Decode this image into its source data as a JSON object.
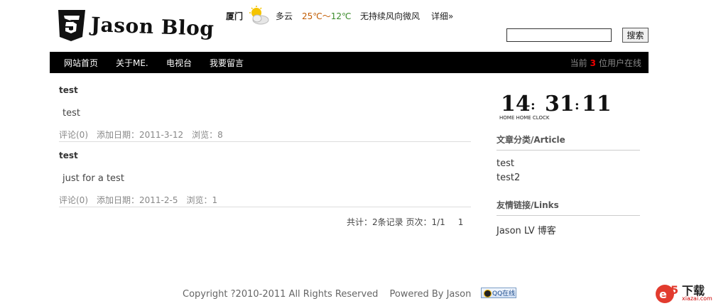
{
  "header": {
    "logo_text": "Jason Blog",
    "weather": {
      "city": "厦门",
      "icon": "partly-cloudy-icon",
      "condition": "多云",
      "temp_high": "25℃",
      "temp_sep": "～",
      "temp_low": "12℃",
      "wind": "无持续风向微风",
      "detail_label": "详细»"
    },
    "search": {
      "value": "",
      "button_label": "搜索"
    }
  },
  "nav": {
    "items": [
      {
        "label": "网站首页"
      },
      {
        "label": "关于ME."
      },
      {
        "label": "电视台"
      },
      {
        "label": "我要留言"
      }
    ],
    "online_prefix": "当前",
    "online_count": "3",
    "online_suffix": "位用户在线"
  },
  "posts": [
    {
      "title": "test",
      "body": "test",
      "comments": "评论(0)",
      "date": "添加日期：2011-3-12",
      "views": "浏览：8"
    },
    {
      "title": "test",
      "body": "just for a test",
      "comments": "评论(0)",
      "date": "添加日期：2011-2-5",
      "views": "浏览：1"
    }
  ],
  "pager": {
    "summary": "共计：2条记录 页次：1/1",
    "page": "1"
  },
  "sidebar": {
    "clock": {
      "h": "14",
      "m": "31",
      "s": "11",
      "caption": "HOME HOME CLOCK"
    },
    "categories_title": "文章分类/Article",
    "categories": [
      {
        "label": "test"
      },
      {
        "label": "test2"
      }
    ],
    "links_title": "友情链接/Links",
    "links": [
      {
        "label": "Jason LV 博客"
      }
    ]
  },
  "footer": {
    "copyright": "Copyright ?2010-2011 All Rights Reserved",
    "powered": "Powered By Jason",
    "qq_label": "QQ在线"
  },
  "watermark": {
    "brand": "下载",
    "site": "xiazai.com"
  },
  "colors": {
    "nav_bg": "#000000",
    "online_count": "#e00000",
    "temp_high": "#c25b00",
    "temp_low": "#3a8a2a"
  }
}
